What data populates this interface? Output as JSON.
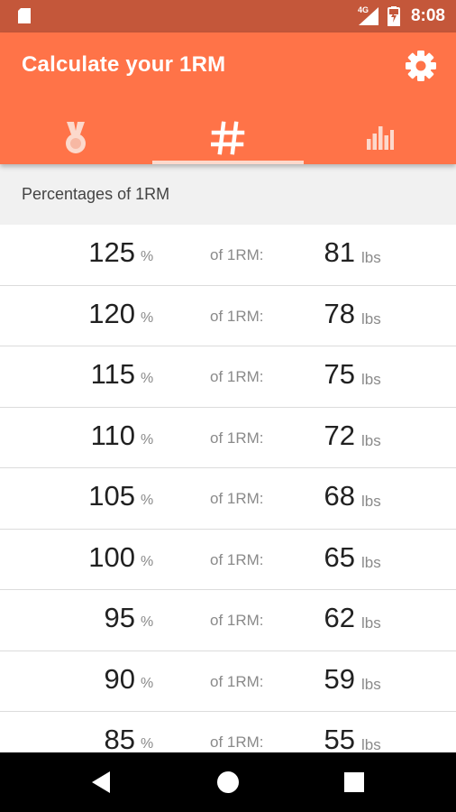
{
  "status_bar": {
    "network": "4G",
    "time": "8:08"
  },
  "app_bar": {
    "title": "Calculate your 1RM",
    "settings_icon": "gear-icon"
  },
  "tabs": [
    {
      "name": "medal",
      "icon": "medal-icon",
      "active": false
    },
    {
      "name": "percentages",
      "icon": "hash-icon",
      "active": true
    },
    {
      "name": "chart",
      "icon": "bar-chart-icon",
      "active": false
    }
  ],
  "section": {
    "title": "Percentages of 1RM"
  },
  "rows": [
    {
      "percent": "125",
      "percent_unit": "%",
      "of_label": "of 1RM:",
      "weight": "81",
      "weight_unit": "lbs"
    },
    {
      "percent": "120",
      "percent_unit": "%",
      "of_label": "of 1RM:",
      "weight": "78",
      "weight_unit": "lbs"
    },
    {
      "percent": "115",
      "percent_unit": "%",
      "of_label": "of 1RM:",
      "weight": "75",
      "weight_unit": "lbs"
    },
    {
      "percent": "110",
      "percent_unit": "%",
      "of_label": "of 1RM:",
      "weight": "72",
      "weight_unit": "lbs"
    },
    {
      "percent": "105",
      "percent_unit": "%",
      "of_label": "of 1RM:",
      "weight": "68",
      "weight_unit": "lbs"
    },
    {
      "percent": "100",
      "percent_unit": "%",
      "of_label": "of 1RM:",
      "weight": "65",
      "weight_unit": "lbs"
    },
    {
      "percent": "95",
      "percent_unit": "%",
      "of_label": "of 1RM:",
      "weight": "62",
      "weight_unit": "lbs"
    },
    {
      "percent": "90",
      "percent_unit": "%",
      "of_label": "of 1RM:",
      "weight": "59",
      "weight_unit": "lbs"
    },
    {
      "percent": "85",
      "percent_unit": "%",
      "of_label": "of 1RM:",
      "weight": "55",
      "weight_unit": "lbs"
    }
  ],
  "nav_bar": {
    "back_icon": "back-triangle-icon",
    "home_icon": "home-circle-icon",
    "recents_icon": "recents-square-icon"
  },
  "colors": {
    "status_bar": "#c4573a",
    "app_bar": "#ff7348",
    "tab_indicator": "#fcd9cc",
    "section_header_bg": "#f1f1f1"
  }
}
